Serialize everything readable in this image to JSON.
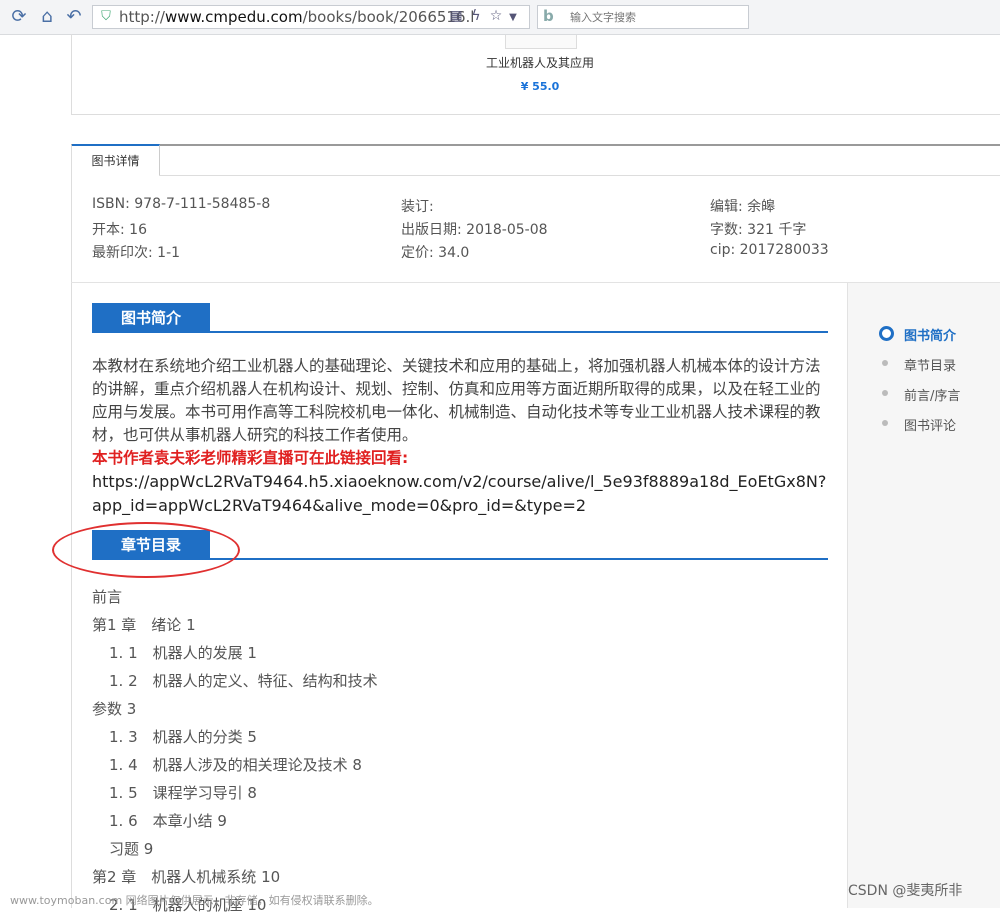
{
  "browser": {
    "url_prefix": "http://",
    "url_domain": "www.cmpedu.com",
    "url_path": "/books/book/2066516.l",
    "search_placeholder": "输入文字搜索"
  },
  "book_card": {
    "name": "工业机器人及其应用",
    "price": "¥ 55.0"
  },
  "details": {
    "tab_label": "图书详情",
    "isbn": "ISBN:  978-7-111-58485-8",
    "format": "开本:  16",
    "printing": "最新印次:  1-1",
    "binding": "装订:",
    "pub_date": "出版日期:  2018-05-08",
    "price": "定价:  34.0",
    "editor": "编辑:  余皞",
    "word_count": "字数:  321 千字",
    "cip": "cip:  2017280033"
  },
  "intro": {
    "heading": "图书简介",
    "text": "本教材在系统地介绍工业机器人的基础理论、关键技术和应用的基础上，将加强机器人机械本体的设计方法的讲解，重点介绍机器人在机构设计、规划、控制、仿真和应用等方面近期所取得的成果，以及在轻工业的应用与发展。本书可用作高等工科院校机电一体化、机械制造、自动化技术等专业工业机器人技术课程的教材，也可供从事机器人研究的科技工作者使用。",
    "live_notice": "本书作者袁夫彩老师精彩直播可在此链接回看:",
    "live_link": "https://appWcL2RVaT9464.h5.xiaoeknow.com/v2/course/alive/l_5e93f8889a18d_EoEtGx8N?app_id=appWcL2RVaT9464&alive_mode=0&pro_id=&type=2"
  },
  "toc": {
    "heading": "章节目录",
    "items": [
      "前言",
      "第1 章　绪论 1",
      "1. 1　机器人的发展 1",
      "1. 2　机器人的定义、特征、结构和技术",
      "参数 3",
      "1. 3　机器人的分类 5",
      "1. 4　机器人涉及的相关理论及技术 8",
      "1. 5　课程学习导引 8",
      "1. 6　本章小结 9",
      "习题 9",
      "第2 章　机器人机械系统 10",
      "2. 1　机器人的机座 10"
    ]
  },
  "sidebar": {
    "items": [
      "图书简介",
      "章节目录",
      "前言/序言",
      "图书评论"
    ]
  },
  "watermarks": {
    "left": "www.toymoban.com 网络图片仅供展示，非存储，如有侵权请联系删除。",
    "right": "CSDN @斐夷所非"
  }
}
